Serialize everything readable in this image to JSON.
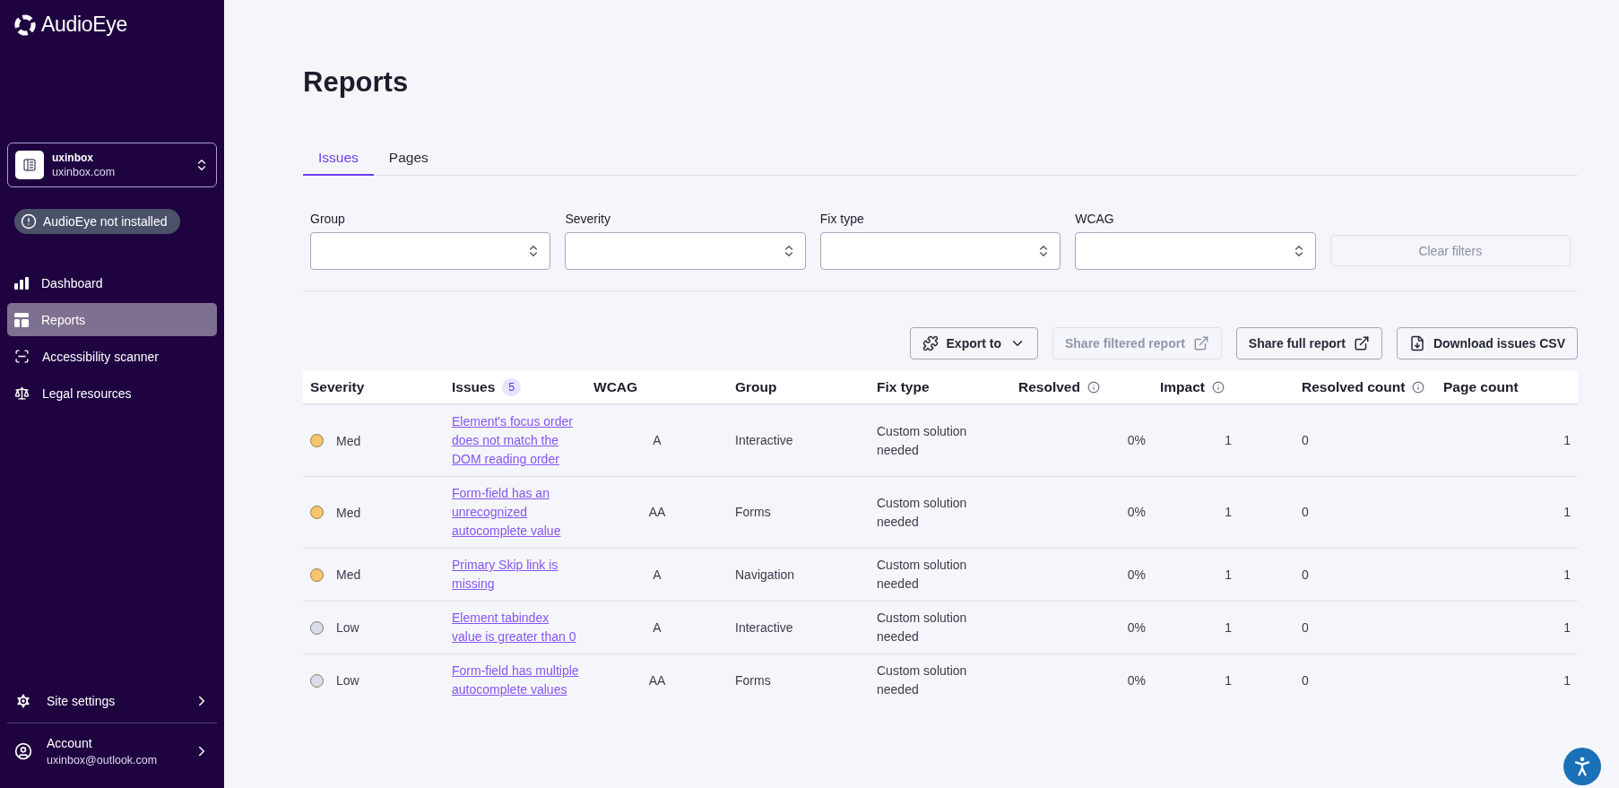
{
  "sidebar": {
    "logo": "AudioEye",
    "site": {
      "name": "uxinbox",
      "domain": "uxinbox.com"
    },
    "status_badge": "AudioEye not installed",
    "nav": [
      {
        "label": "Dashboard",
        "kind": "chart",
        "selected": false
      },
      {
        "label": "Reports",
        "kind": "table",
        "selected": true
      },
      {
        "label": "Accessibility scanner",
        "kind": "scan",
        "selected": false
      },
      {
        "label": "Legal resources",
        "kind": "scale",
        "selected": false
      }
    ],
    "settings": {
      "label": "Site settings"
    },
    "account": {
      "label": "Account",
      "email": "uxinbox@outlook.com"
    }
  },
  "main": {
    "title": "Reports",
    "tabs": [
      {
        "label": "Issues",
        "selected": true
      },
      {
        "label": "Pages",
        "selected": false
      }
    ],
    "filters": [
      {
        "label": "Group"
      },
      {
        "label": "Severity"
      },
      {
        "label": "Fix type"
      },
      {
        "label": "WCAG"
      }
    ],
    "clear_filters": {
      "label": "Clear filters",
      "disabled": true
    },
    "actions": [
      {
        "label": "Export to",
        "kind": "export",
        "disabled": false
      },
      {
        "label": "Share filtered report",
        "kind": "share",
        "disabled": true
      },
      {
        "label": "Share full report",
        "kind": "share",
        "disabled": false
      },
      {
        "label": "Download issues CSV",
        "kind": "download",
        "disabled": false
      }
    ],
    "table": {
      "columns": [
        {
          "label": "Severity"
        },
        {
          "label": "Issues",
          "badge": "5"
        },
        {
          "label": "WCAG"
        },
        {
          "label": "Group"
        },
        {
          "label": "Fix type"
        },
        {
          "label": "Resolved",
          "info": true
        },
        {
          "label": "Impact",
          "info": true
        },
        {
          "label": "Resolved count",
          "info": true
        },
        {
          "label": "Page count"
        }
      ],
      "rows": [
        {
          "severity": "Med",
          "color": "#f7c56b",
          "issue": "Element's focus order does not match the DOM reading order",
          "wcag": "A",
          "group": "Interactive",
          "fix_type": "Custom solution needed",
          "resolved": "0%",
          "impact": "1",
          "resolved_count": "0",
          "page_count": "1"
        },
        {
          "severity": "Med",
          "color": "#f7c56b",
          "issue": "Form-field has an unrecognized autocomplete value",
          "wcag": "AA",
          "group": "Forms",
          "fix_type": "Custom solution needed",
          "resolved": "0%",
          "impact": "1",
          "resolved_count": "0",
          "page_count": "1"
        },
        {
          "severity": "Med",
          "color": "#f7c56b",
          "issue": "Primary Skip link is missing",
          "wcag": "A",
          "group": "Navigation",
          "fix_type": "Custom solution needed",
          "resolved": "0%",
          "impact": "1",
          "resolved_count": "0",
          "page_count": "1"
        },
        {
          "severity": "Low",
          "color": "#dadcec",
          "issue": "Element tabindex value is greater than 0",
          "wcag": "A",
          "group": "Interactive",
          "fix_type": "Custom solution needed",
          "resolved": "0%",
          "impact": "1",
          "resolved_count": "0",
          "page_count": "1"
        },
        {
          "severity": "Low",
          "color": "#dadcec",
          "issue": "Form-field has multiple autocomplete values",
          "wcag": "AA",
          "group": "Forms",
          "fix_type": "Custom solution needed",
          "resolved": "0%",
          "impact": "1",
          "resolved_count": "0",
          "page_count": "1"
        }
      ]
    }
  }
}
